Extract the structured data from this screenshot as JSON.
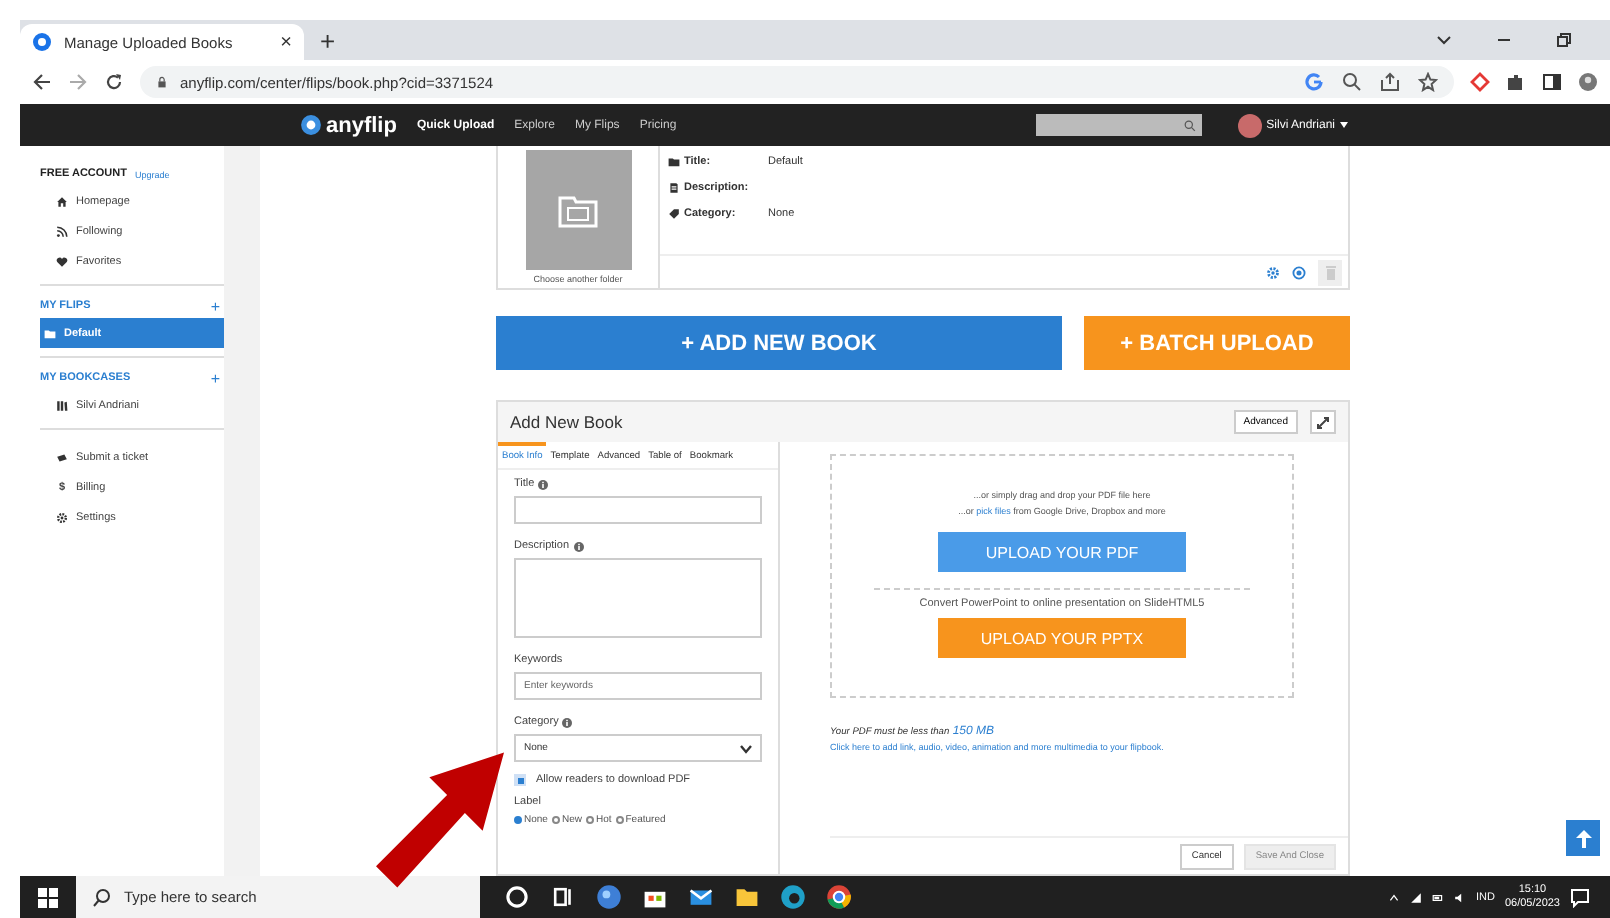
{
  "browser": {
    "tab": {
      "title": "Manage Uploaded Books",
      "close": "×"
    },
    "new_tab": "+",
    "url": "anyflip.com/center/flips/book.php?cid=3371524"
  },
  "site_nav": {
    "logo": "anyflip",
    "links": [
      {
        "label": "Quick Upload",
        "selected": true
      },
      {
        "label": "Explore",
        "selected": false
      },
      {
        "label": "My Flips",
        "selected": false
      },
      {
        "label": "Pricing",
        "selected": false
      }
    ],
    "user": "Silvi Andriani"
  },
  "sidebar": {
    "groups": [
      {
        "kind": "account",
        "heading": "FREE ACCOUNT",
        "link": "Upgrade",
        "items": [
          {
            "label": "Homepage",
            "selected": false
          },
          {
            "label": "Following",
            "selected": false
          },
          {
            "label": "Favorites",
            "selected": false
          }
        ]
      },
      {
        "kind": "section",
        "heading": "MY FLIPS",
        "add": "+",
        "items": [
          {
            "label": "Default",
            "selected": true
          }
        ]
      },
      {
        "kind": "section",
        "heading": "MY BOOKCASES",
        "add": "+",
        "items": [
          {
            "label": "Silvi Andriani",
            "selected": false
          }
        ]
      },
      {
        "kind": "plain",
        "items": [
          {
            "label": "Submit a ticket",
            "selected": false
          },
          {
            "label": "Billing",
            "glyph": "$",
            "selected": false
          },
          {
            "label": "Settings",
            "selected": false
          }
        ]
      }
    ]
  },
  "folder_card": {
    "fields": [
      {
        "label": "Title:",
        "value": "Default"
      },
      {
        "label": "Description:"
      },
      {
        "label": "Category:",
        "value": "None"
      }
    ],
    "change_folder": "Choose another folder"
  },
  "actions": {
    "add_book": "+ ADD NEW BOOK",
    "batch_upload": "+ BATCH UPLOAD"
  },
  "panel": {
    "title": "Add New Book",
    "advanced": "Advanced",
    "tabs": [
      {
        "label": "Book Info",
        "selected": true
      },
      {
        "label": "Template",
        "selected": false
      },
      {
        "label": "Advanced",
        "selected": false
      },
      {
        "label": "Table of",
        "selected": false
      },
      {
        "label": "Bookmark",
        "selected": false
      }
    ],
    "fields": [
      {
        "kind": "input",
        "label": "Title",
        "info": true
      },
      {
        "kind": "textarea",
        "label": "Description",
        "info": true
      },
      {
        "kind": "input",
        "label": "Keywords",
        "info": false,
        "placeholder": "Enter keywords"
      },
      {
        "kind": "select",
        "label": "Category",
        "info": true,
        "value": "None"
      }
    ],
    "download": {
      "label": "Allow readers to download PDF",
      "checked": true
    },
    "label_group": {
      "label": "Label",
      "options": [
        {
          "label": "None",
          "selected": true
        },
        {
          "label": "New",
          "selected": false
        },
        {
          "label": "Hot",
          "selected": false
        },
        {
          "label": "Featured",
          "selected": false
        }
      ]
    },
    "upload": {
      "drag_text": "...or simply drag and drop your PDF file here",
      "pick_prefix": "...or ",
      "pick_link": "pick files",
      "pick_suffix": " from Google Drive, Dropbox and more",
      "pdf_button": "UPLOAD YOUR PDF",
      "convert_text": "Convert PowerPoint to online presentation on SlideHTML5",
      "pptx_button": "UPLOAD YOUR PPTX"
    },
    "size_note": "Your PDF must be less than ",
    "size_limit": "150 MB",
    "multimedia_link": "Click here to add link, audio, video, animation and more multimedia to your flipbook.",
    "footer": [
      {
        "label": "Cancel",
        "disabled": false
      },
      {
        "label": "Save And Close",
        "disabled": true
      }
    ]
  },
  "taskbar": {
    "search_placeholder": "Type here to search",
    "language": "IND",
    "time": "15:10",
    "date": "06/05/2023"
  }
}
